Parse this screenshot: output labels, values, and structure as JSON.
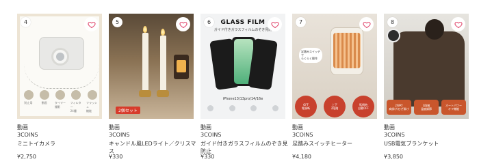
{
  "products": [
    {
      "rank": "4",
      "category": "動画",
      "brand": "3COINS",
      "name": "ミニトイカメラ",
      "price": "¥2,750",
      "features": [
        "防止用",
        "動画",
        "タイマー\n撮影",
        "フィルター\n24種",
        "フラッシュ\n機能"
      ]
    },
    {
      "rank": "5",
      "category": "動画",
      "brand": "3COINS",
      "name": "キャンドル風LEDライト／クリスマス",
      "price": "¥330",
      "badge": "2個セット"
    },
    {
      "rank": "6",
      "category": "動画",
      "brand": "3COINS",
      "name": "ガイド付きガラスフィルムのぞき見防止",
      "price": "¥330",
      "image_title": "GLASS FILM",
      "image_subtitle": "ガイド付きガラスフィルムのぞき見防",
      "image_models": "iPhone13/13pro/14/16e"
    },
    {
      "rank": "7",
      "category": "動画",
      "brand": "3COINS",
      "name": "足踏みスイッチヒーター",
      "price": "¥4,180",
      "bubble": "足踏みスイッチで\nらくらく操作",
      "circles": [
        "OFF\n電源断",
        "上下\n2段階",
        "転倒時\n自動OFF"
      ]
    },
    {
      "rank": "8",
      "category": "動画",
      "brand": "3COINS",
      "name": "USB電気ブランケット",
      "price": "¥3,850",
      "badges": [
        "2WAY\n肩掛け/ひざ掛け",
        "3段階\n温度調節",
        "オートパワー\nオフ機能"
      ]
    }
  ],
  "colors": {
    "heart": "#e0456b",
    "text": "#333333",
    "accent_red": "#d73b2b"
  },
  "icons": {
    "favorite": "heart-outline-icon"
  }
}
